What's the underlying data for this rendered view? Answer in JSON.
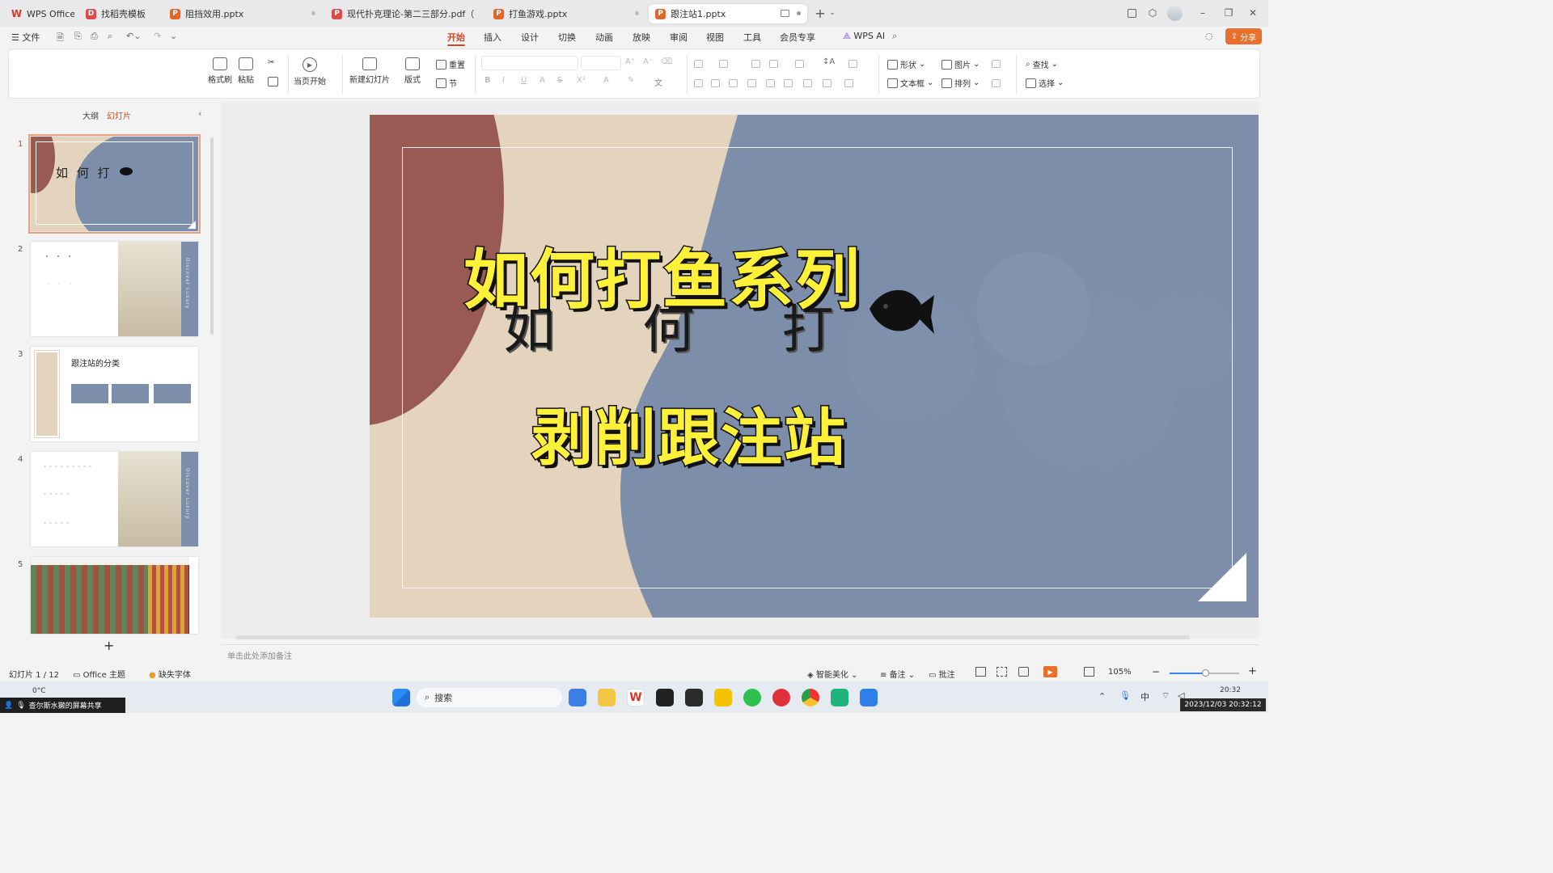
{
  "tabs": [
    {
      "label": "WPS Office",
      "icon": "W"
    },
    {
      "label": "找稻壳模板",
      "icon": "D"
    },
    {
      "label": "阻挡效用.pptx",
      "icon": "P"
    },
    {
      "label": "现代扑克理论-第二三部分.pdf（已加",
      "icon": "P"
    },
    {
      "label": "打鱼游戏.pptx",
      "icon": "P"
    },
    {
      "label": "跟注站1.pptx",
      "icon": "P"
    }
  ],
  "menubar": {
    "file": "文件",
    "items": [
      "开始",
      "插入",
      "设计",
      "切换",
      "动画",
      "放映",
      "审阅",
      "视图",
      "工具",
      "会员专享"
    ],
    "active": "开始",
    "wps_ai": "WPS AI",
    "share": "分享"
  },
  "ribbon": {
    "format_painter": "格式刷",
    "paste": "粘贴",
    "play_current": "当页开始",
    "new_slide": "新建幻灯片",
    "layout": "版式",
    "reset": "重置",
    "section": "节",
    "shape": "形状",
    "picture": "图片",
    "textbox": "文本框",
    "arrange": "排列",
    "find": "查找",
    "select": "选择"
  },
  "panel": {
    "outline": "大纲",
    "slides": "幻灯片",
    "add": "+"
  },
  "thumbnails": {
    "t1_text": "如 何 打",
    "t3_title": "跟注站的分类",
    "t2_side": "Discover Luxury",
    "t4_side": "Discover Luxury"
  },
  "slide": {
    "title_line1": "如何打鱼系列",
    "title_line2": "剥削跟注站",
    "under_text": "如  何  打"
  },
  "notes_placeholder": "单击此处添加备注",
  "status": {
    "slide_count": "幻灯片 1 / 12",
    "theme": "Office 主题",
    "missing_font": "缺失字体",
    "beautify": "智能美化",
    "notes": "备注",
    "comment": "批注",
    "zoom": "105%"
  },
  "taskbar": {
    "weather": "0°C",
    "search": "搜索",
    "screen_share": "查尔斯水獭的屏幕共享",
    "ime": "中",
    "time": "20:32",
    "datetime": "2023/12/03 20:32:12"
  },
  "colors": {
    "accent": "#d14924",
    "slide_red": "#985a52",
    "slide_beige": "#e4d4bd",
    "slide_blue": "#7c8ea9",
    "title_yellow": "#fff13a"
  }
}
